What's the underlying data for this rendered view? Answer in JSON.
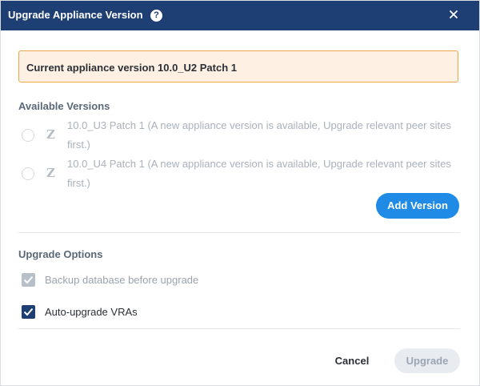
{
  "dialog": {
    "title": "Upgrade Appliance Version",
    "help_icon": "?",
    "close_icon": "close-icon"
  },
  "banner": {
    "text": "Current appliance version 10.0_U2 Patch 1",
    "bg_color": "#fef1e3",
    "border_color": "#e8a94a"
  },
  "available_versions": {
    "heading": "Available Versions",
    "items": [
      {
        "icon": "Z",
        "label": "10.0_U3 Patch 1 (A new appliance version is available, Upgrade relevant peer sites first.)",
        "selected": false
      },
      {
        "icon": "Z",
        "label": "10.0_U4 Patch 1 (A new appliance version is available, Upgrade relevant peer sites first.)",
        "selected": false
      }
    ],
    "add_button": "Add Version"
  },
  "upgrade_options": {
    "heading": "Upgrade Options",
    "options": [
      {
        "label": "Backup database before upgrade",
        "checked": true,
        "disabled": true
      },
      {
        "label": "Auto-upgrade VRAs",
        "checked": true,
        "disabled": false
      }
    ]
  },
  "footer": {
    "cancel": "Cancel",
    "upgrade": "Upgrade"
  },
  "colors": {
    "header": "#1e3f73",
    "accent": "#1f8be6",
    "disabled_button": "#e8ecf1"
  }
}
